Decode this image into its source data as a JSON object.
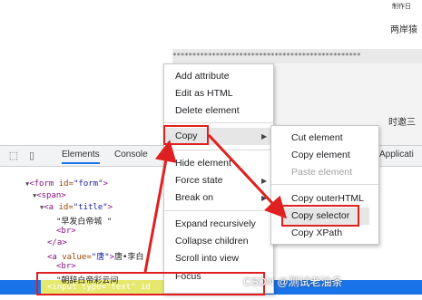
{
  "background": {
    "top_right_text": "制作日",
    "line1_text": "两岸猿",
    "stars": "************************************************",
    "line2_text": "时邀三"
  },
  "devtools": {
    "tabs": [
      "Elements",
      "Console"
    ],
    "right_tab_fragment": "Applicati",
    "dom_lines": {
      "form": {
        "tag_open": "<form",
        "attr": " id=",
        "val": "\"form\"",
        "tag_close": ">"
      },
      "span": {
        "tag": "<span>"
      },
      "a_title": {
        "tag_open": "<a",
        "attr": " id=",
        "val": "\"title\"",
        "tag_close": ">"
      },
      "title_text": "\"早发白帝城 \"",
      "br1": "<br>",
      "a_close": "</a>",
      "a_value": {
        "tag_open": "<a",
        "attr": " value=",
        "val": "\"唐\"",
        "tag_close": ">",
        "text": "唐•李白"
      },
      "br2": "<br>",
      "partial": "\"朝辞白帝彩云间",
      "input_line": {
        "tag_open": "<input",
        "attr": " type=",
        "val": "\"text\"",
        "rest": " id"
      }
    }
  },
  "context_menu": {
    "items": [
      "Add attribute",
      "Edit as HTML",
      "Delete element",
      "Copy",
      "Hide element",
      "Force state",
      "Break on",
      "Expand recursively",
      "Collapse children",
      "Scroll into view",
      "Focus"
    ]
  },
  "copy_submenu": {
    "items": [
      "Cut element",
      "Copy element",
      "Paste element",
      "Copy outerHTML",
      "Copy selector",
      "Copy XPath"
    ]
  },
  "watermark": "CSDN @测试老油条"
}
